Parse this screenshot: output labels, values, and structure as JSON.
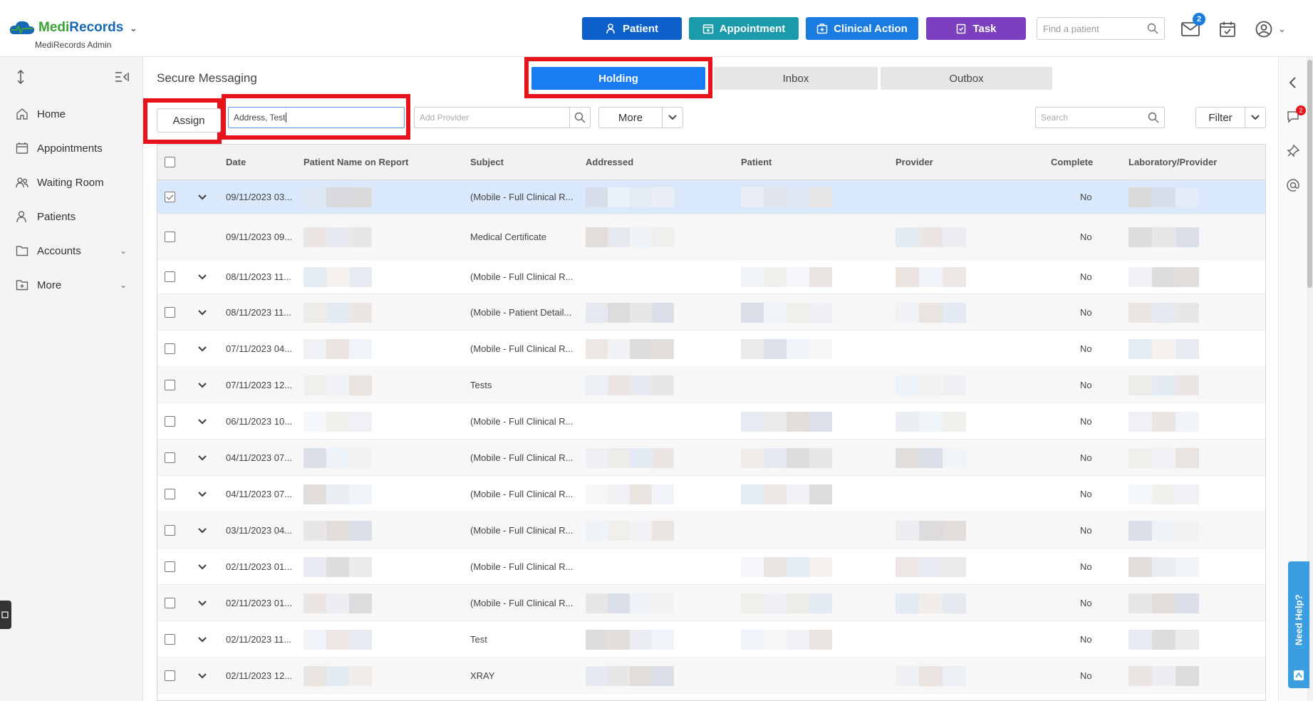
{
  "app": {
    "logo_part1": "Medi",
    "logo_part2": "Records",
    "account_label": "MediRecords Admin"
  },
  "topbar": {
    "patient_btn": "Patient",
    "appointment_btn": "Appointment",
    "clinical_btn": "Clinical Action",
    "task_btn": "Task",
    "find_placeholder": "Find a patient",
    "mail_count": "2"
  },
  "colors": {
    "patient": "#0d5fc9",
    "appointment": "#1b9aaa",
    "clinical": "#1a7be0",
    "task": "#7b3fbf",
    "active_tab": "#1a7cf2",
    "highlight": "#e8141c"
  },
  "sidebar": {
    "items": [
      {
        "label": "Home",
        "icon": "home-icon"
      },
      {
        "label": "Appointments",
        "icon": "calendar-icon"
      },
      {
        "label": "Waiting Room",
        "icon": "users-icon"
      },
      {
        "label": "Patients",
        "icon": "user-icon"
      },
      {
        "label": "Accounts",
        "icon": "folder-icon"
      },
      {
        "label": "More",
        "icon": "folder-plus-icon"
      }
    ]
  },
  "page": {
    "title": "Secure Messaging",
    "tabs": [
      "Holding",
      "Inbox",
      "Outbox"
    ]
  },
  "toolbar": {
    "assign": "Assign",
    "address_value": "Address, Test",
    "provider_placeholder": "Add Provider",
    "more": "More",
    "search_placeholder": "Search",
    "filter": "Filter"
  },
  "table": {
    "columns": [
      "Date",
      "Patient Name on Report",
      "Subject",
      "Addressed",
      "Patient",
      "Provider",
      "Complete",
      "Laboratory/Provider"
    ],
    "rows": [
      {
        "date": "09/11/2023 03...",
        "subject": "(Mobile - Full Clinical R...",
        "complete": "No",
        "checked": true,
        "expand": true
      },
      {
        "date": "09/11/2023 09...",
        "subject": "Medical Certificate",
        "complete": "No",
        "checked": false,
        "expand": false
      },
      {
        "date": "08/11/2023 11...",
        "subject": "(Mobile - Full Clinical R...",
        "complete": "No",
        "checked": false,
        "expand": true
      },
      {
        "date": "08/11/2023 11...",
        "subject": "(Mobile - Patient Detail...",
        "complete": "No",
        "checked": false,
        "expand": true
      },
      {
        "date": "07/11/2023 04...",
        "subject": "(Mobile - Full Clinical R...",
        "complete": "No",
        "checked": false,
        "expand": true
      },
      {
        "date": "07/11/2023 12...",
        "subject": "Tests",
        "complete": "No",
        "checked": false,
        "expand": true
      },
      {
        "date": "06/11/2023 10...",
        "subject": "(Mobile - Full Clinical R...",
        "complete": "No",
        "checked": false,
        "expand": true
      },
      {
        "date": "04/11/2023 07...",
        "subject": "(Mobile - Full Clinical R...",
        "complete": "No",
        "checked": false,
        "expand": true
      },
      {
        "date": "04/11/2023 07...",
        "subject": "(Mobile - Full Clinical R...",
        "complete": "No",
        "checked": false,
        "expand": true
      },
      {
        "date": "03/11/2023 04...",
        "subject": "(Mobile - Full Clinical R...",
        "complete": "No",
        "checked": false,
        "expand": true
      },
      {
        "date": "02/11/2023 01...",
        "subject": "(Mobile - Full Clinical R...",
        "complete": "No",
        "checked": false,
        "expand": true
      },
      {
        "date": "02/11/2023 01...",
        "subject": "(Mobile - Full Clinical R...",
        "complete": "No",
        "checked": false,
        "expand": true
      },
      {
        "date": "02/11/2023 11...",
        "subject": "Test",
        "complete": "No",
        "checked": false,
        "expand": true
      },
      {
        "date": "02/11/2023 12...",
        "subject": "XRAY",
        "complete": "No",
        "checked": false,
        "expand": true
      }
    ]
  },
  "rail": {
    "notif_count": "2"
  },
  "help": {
    "label": "Need Help?"
  }
}
